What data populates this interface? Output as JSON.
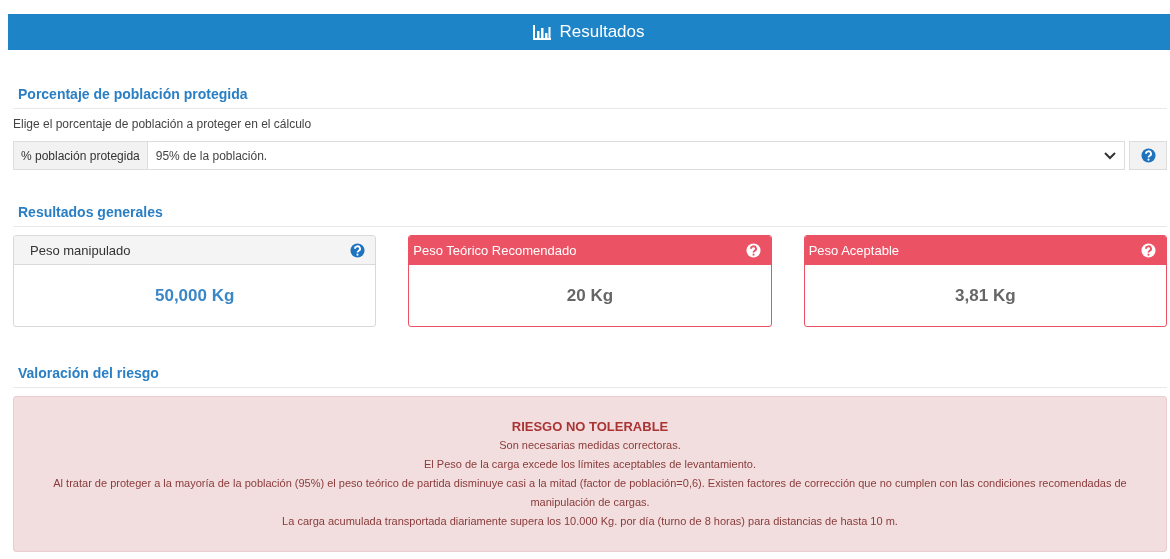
{
  "header": {
    "title": "Resultados"
  },
  "population": {
    "heading": "Porcentaje de población protegida",
    "description": "Elige el porcentaje de población a proteger en el cálculo",
    "label": "% población protegida",
    "value": "95% de la población."
  },
  "general": {
    "heading": "Resultados generales",
    "cards": [
      {
        "title": "Peso manipulado",
        "value": "50,000 Kg",
        "kind": "info"
      },
      {
        "title": "Peso Teórico Recomendado",
        "value": "20 Kg",
        "kind": "danger"
      },
      {
        "title": "Peso Aceptable",
        "value": "3,81 Kg",
        "kind": "danger"
      }
    ]
  },
  "risk": {
    "heading": "Valoración del riesgo",
    "title": "RIESGO NO TOLERABLE",
    "lines": [
      "Son necesarias medidas correctoras.",
      "El Peso de la carga excede los límites aceptables de levantamiento.",
      "Al tratar de proteger a la mayoría de la población (95%) el peso teórico de partida disminuye casi a la mitad (factor de población=0,6). Existen factores de corrección que no cumplen con las condiciones recomendadas de manipulación de cargas.",
      "La carga acumulada transportada diariamente supera los 10.000 Kg. por día (turno de 8 horas) para distancias de hasta 10 m."
    ]
  }
}
